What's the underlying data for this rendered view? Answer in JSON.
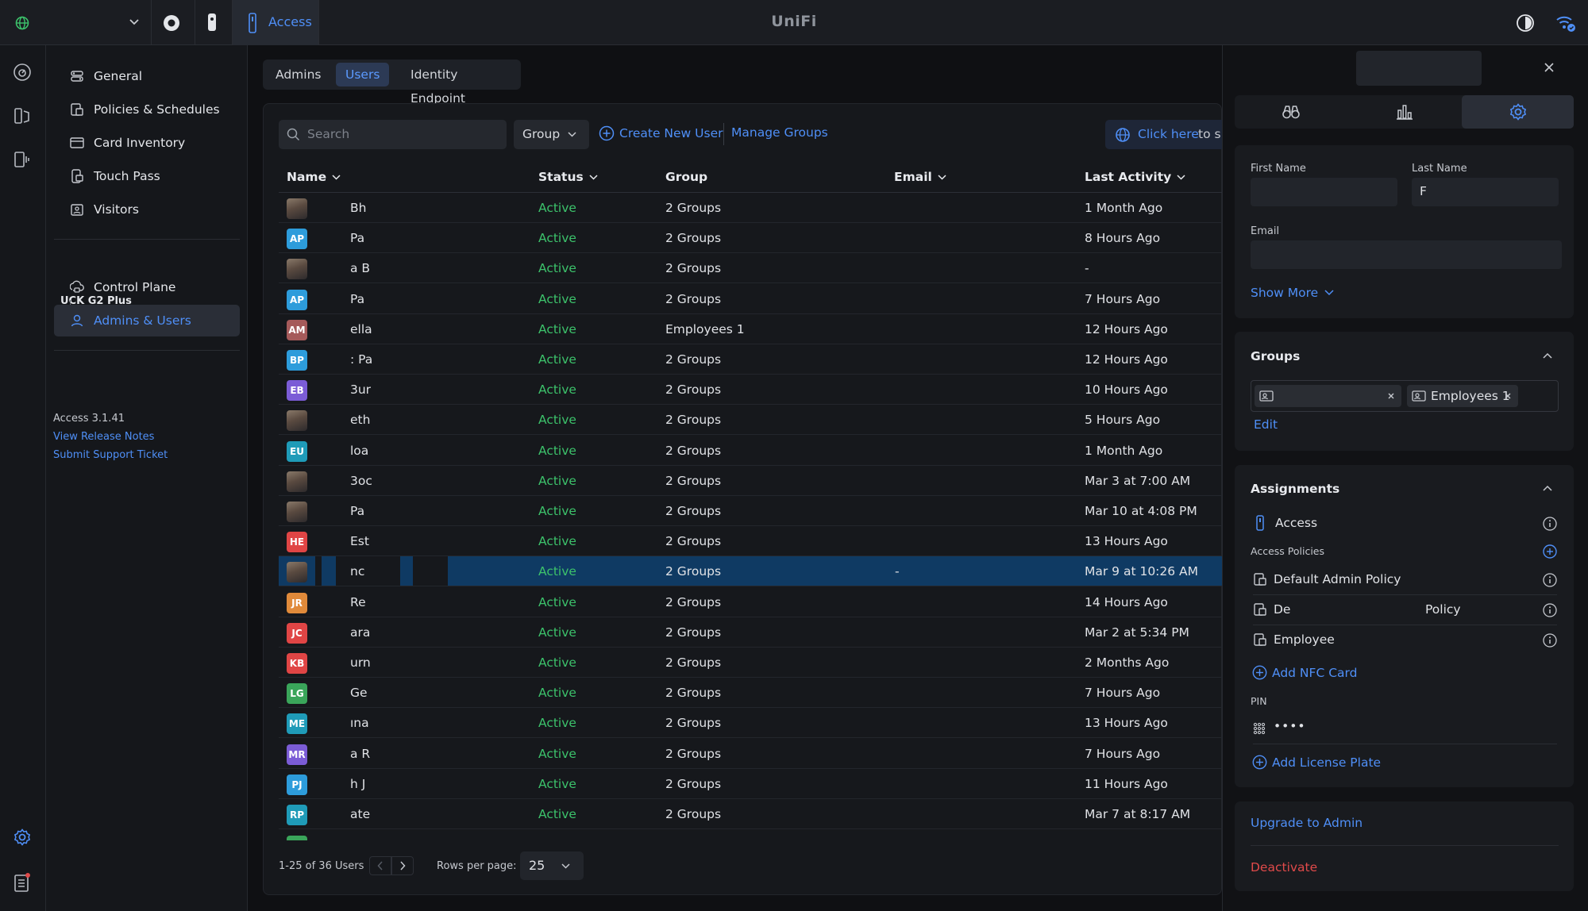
{
  "app": {
    "title": "UniFi",
    "active_app": "Access"
  },
  "nav": {
    "items": [
      {
        "label": "General"
      },
      {
        "label": "Policies & Schedules"
      },
      {
        "label": "Card Inventory"
      },
      {
        "label": "Touch Pass"
      },
      {
        "label": "Visitors"
      }
    ],
    "section_title": "UCK G2 Plus",
    "section_items": [
      {
        "label": "Control Plane"
      },
      {
        "label": "Admins & Users"
      }
    ],
    "version": "Access 3.1.41",
    "release_notes": "View Release Notes",
    "support": "Submit Support Ticket"
  },
  "tabs": [
    "Admins",
    "Users",
    "Identity Endpoint"
  ],
  "toolbar": {
    "search_placeholder": "Search",
    "group_filter": "Group",
    "create_user": "Create New User",
    "manage_groups": "Manage Groups",
    "click_here": "Click here",
    "click_here_suffix": "to s"
  },
  "table": {
    "headers": {
      "name": "Name",
      "status": "Status",
      "group": "Group",
      "email": "Email",
      "last_activity": "Last Activity"
    },
    "rows": [
      {
        "initials": "",
        "photo": true,
        "name": "Bh",
        "status": "Active",
        "group": "2 Groups",
        "email": "",
        "last": "1 Month Ago"
      },
      {
        "initials": "AP",
        "color": "#2d9cdb",
        "name": "Pa",
        "status": "Active",
        "group": "2 Groups",
        "email": "",
        "last": "8 Hours Ago"
      },
      {
        "initials": "",
        "photo": true,
        "name": "a B",
        "status": "Active",
        "group": "2 Groups",
        "email": "",
        "last": "-"
      },
      {
        "initials": "AP",
        "color": "#2d9cdb",
        "name": "Pa",
        "status": "Active",
        "group": "2 Groups",
        "email": "",
        "last": "7 Hours Ago"
      },
      {
        "initials": "AM",
        "color": "#a55a5a",
        "name": "ella",
        "status": "Active",
        "group": "Employees 1",
        "email": "",
        "last": "12 Hours Ago"
      },
      {
        "initials": "BP",
        "color": "#2d9cdb",
        "name": ": Pa",
        "status": "Active",
        "group": "2 Groups",
        "email": "",
        "last": "12 Hours Ago"
      },
      {
        "initials": "EB",
        "color": "#7b5cd6",
        "name": "3ur",
        "status": "Active",
        "group": "2 Groups",
        "email": "",
        "last": "10 Hours Ago"
      },
      {
        "initials": "",
        "photo": true,
        "name": "eth",
        "status": "Active",
        "group": "2 Groups",
        "email": "",
        "last": "5 Hours Ago"
      },
      {
        "initials": "EU",
        "color": "#1f9bb8",
        "name": "loa",
        "status": "Active",
        "group": "2 Groups",
        "email": "",
        "last": "1 Month Ago"
      },
      {
        "initials": "",
        "photo": true,
        "name": "3oc",
        "status": "Active",
        "group": "2 Groups",
        "email": "",
        "last": "Mar 3 at 7:00 AM"
      },
      {
        "initials": "",
        "photo": true,
        "name": "Pa",
        "status": "Active",
        "group": "2 Groups",
        "email": "",
        "last": "Mar 10 at 4:08 PM"
      },
      {
        "initials": "HE",
        "color": "#e04545",
        "name": "Est",
        "status": "Active",
        "group": "2 Groups",
        "email": "",
        "last": "13 Hours Ago"
      },
      {
        "initials": "",
        "photo": true,
        "name": "nc",
        "status": "Active",
        "group": "2 Groups",
        "email": "-",
        "last": "Mar 9 at 10:26 AM",
        "selected": true
      },
      {
        "initials": "JR",
        "color": "#e08a3a",
        "name": "Re",
        "status": "Active",
        "group": "2 Groups",
        "email": "",
        "last": "14 Hours Ago"
      },
      {
        "initials": "JC",
        "color": "#e04545",
        "name": "ara",
        "status": "Active",
        "group": "2 Groups",
        "email": "",
        "last": "Mar 2 at 5:34 PM"
      },
      {
        "initials": "KB",
        "color": "#e04545",
        "name": "urn",
        "status": "Active",
        "group": "2 Groups",
        "email": "",
        "last": "2 Months Ago"
      },
      {
        "initials": "LG",
        "color": "#3aa55a",
        "name": "Ge",
        "status": "Active",
        "group": "2 Groups",
        "email": "",
        "last": "7 Hours Ago"
      },
      {
        "initials": "ME",
        "color": "#1f9bb8",
        "name": "ına",
        "status": "Active",
        "group": "2 Groups",
        "email": "",
        "last": "13 Hours Ago"
      },
      {
        "initials": "MR",
        "color": "#7b5cd6",
        "name": "a R",
        "status": "Active",
        "group": "2 Groups",
        "email": "",
        "last": "7 Hours Ago"
      },
      {
        "initials": "PJ",
        "color": "#2d9cdb",
        "name": "h J",
        "status": "Active",
        "group": "2 Groups",
        "email": "",
        "last": "11 Hours Ago"
      },
      {
        "initials": "RP",
        "color": "#1f9bb8",
        "name": "ate",
        "status": "Active",
        "group": "2 Groups",
        "email": "",
        "last": "Mar 7 at 8:17 AM"
      }
    ]
  },
  "pager": {
    "range": "1-25 of 36 Users",
    "rows_label": "Rows per page:",
    "rows_value": "25"
  },
  "panel": {
    "first_name_label": "First Name",
    "first_name_value": "",
    "last_name_label": "Last Name",
    "last_name_value": "F",
    "email_label": "Email",
    "email_value": "",
    "show_more": "Show More",
    "groups_title": "Groups",
    "group_chip_1": "",
    "group_chip_2": "Employees 1",
    "edit": "Edit",
    "assignments_title": "Assignments",
    "access": "Access",
    "access_policies": "Access Policies",
    "policy_1": "Default Admin Policy",
    "policy_2a": "De",
    "policy_2b": "Policy",
    "policy_3": "Employee",
    "add_nfc": "Add NFC Card",
    "pin_label": "PIN",
    "pin_value": "••••",
    "add_plate": "Add License Plate",
    "upgrade": "Upgrade to Admin",
    "deactivate": "Deactivate"
  },
  "colors": {
    "accent": "#4f8ff7",
    "active": "#3cc26b",
    "danger": "#e04a4a",
    "selected_row": "#0f3a63"
  }
}
